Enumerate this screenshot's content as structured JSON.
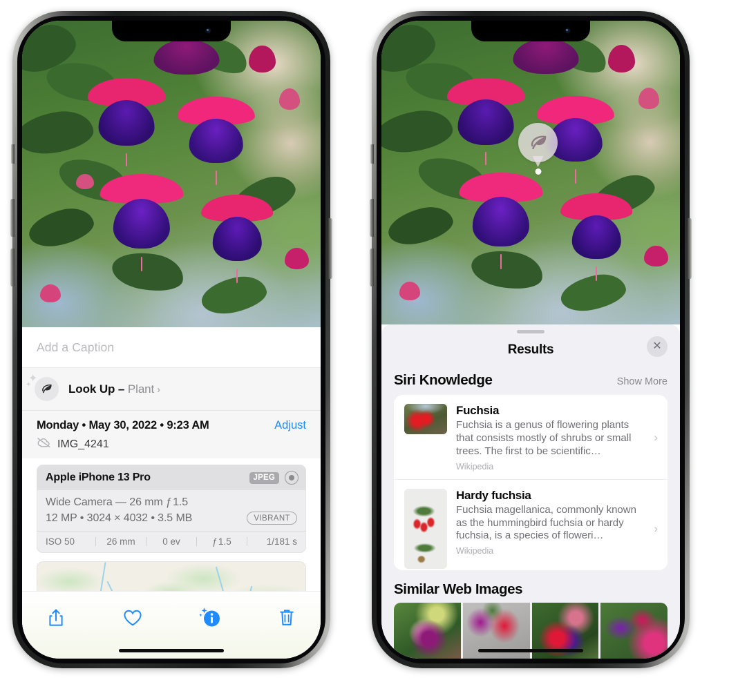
{
  "left_phone": {
    "photo": {
      "alt_name": "fuchsia-flowers-photo"
    },
    "caption_placeholder": "Add a Caption",
    "lookup": {
      "icon": "leaf-icon",
      "sparkle_icon": "sparkle-icon",
      "label": "Look Up – ",
      "subject": "Plant",
      "chevron": "›"
    },
    "meta": {
      "date": "Monday • May 30, 2022 • 9:23 AM",
      "adjust_label": "Adjust",
      "cloud_icon": "cloud-slash-icon",
      "filename": "IMG_4241"
    },
    "camera": {
      "model": "Apple iPhone 13 Pro",
      "format_badge": "JPEG",
      "raw_icon": "raw-circle-icon",
      "lens_line": "Wide Camera — 26 mm ƒ 1.5",
      "spec_line": "12 MP • 3024 × 4032 • 3.5 MB",
      "style_badge": "VIBRANT",
      "exif": [
        "ISO 50",
        "26 mm",
        "0 ev",
        "ƒ 1.5",
        "1/181 s"
      ]
    },
    "map": {
      "name": "location-map-preview"
    },
    "toolbar": [
      {
        "name": "share-button",
        "icon": "share-icon"
      },
      {
        "name": "favorite-button",
        "icon": "heart-icon"
      },
      {
        "name": "info-button",
        "icon": "info-sparkle-icon"
      },
      {
        "name": "delete-button",
        "icon": "trash-icon"
      }
    ],
    "accent_color": "#1f8bff"
  },
  "right_phone": {
    "photo_pin": {
      "icon": "leaf-icon",
      "name": "visual-lookup-leaf-pin"
    },
    "sheet": {
      "title": "Results",
      "close_icon": "close-icon",
      "grabber": "sheet-grabber"
    },
    "siri_knowledge": {
      "title": "Siri Knowledge",
      "show_more": "Show More",
      "items": [
        {
          "title": "Fuchsia",
          "description": "Fuchsia is a genus of flowering plants that consists mostly of shrubs or small trees. The first to be scientific…",
          "source": "Wikipedia",
          "thumb": "fuchsia-red-flowers-thumb"
        },
        {
          "title": "Hardy fuchsia",
          "description": "Fuchsia magellanica, commonly known as the hummingbird fuchsia or hardy fuchsia, is a species of floweri…",
          "source": "Wikipedia",
          "thumb": "hardy-fuchsia-specimen-thumb"
        }
      ]
    },
    "similar_web_images": {
      "title": "Similar Web Images",
      "images": [
        {
          "name": "web-image-1"
        },
        {
          "name": "web-image-2"
        },
        {
          "name": "web-image-3"
        },
        {
          "name": "web-image-4"
        }
      ]
    }
  }
}
